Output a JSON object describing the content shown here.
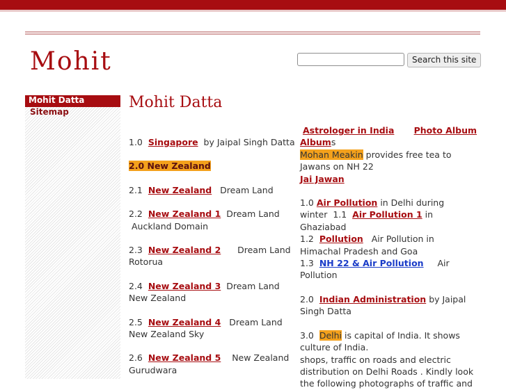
{
  "site": {
    "title": "Mohit"
  },
  "search": {
    "placeholder": "",
    "button_label": "Search this site"
  },
  "sidebar": {
    "items": [
      {
        "label": "Mohit Datta",
        "active": true
      },
      {
        "label": "Sitemap",
        "active": false
      }
    ]
  },
  "page": {
    "heading": "Mohit Datta"
  },
  "left_column": {
    "e1": {
      "num": "1.0",
      "link": "Singapore",
      "text": "by Jaipal Singh Datta"
    },
    "e2": {
      "label": "2.0  New Zealand"
    },
    "e3": {
      "num": "2.1",
      "link": "New Zealand",
      "text": "Dream Land"
    },
    "e4": {
      "num": "2.2",
      "link": "New Zealand 1",
      "text": "Dream Land",
      "text2": "Auckland Domain"
    },
    "e5": {
      "num": "2.3",
      "link": "New Zealand 2",
      "text": "Dream Land",
      "text2": "Rotorua"
    },
    "e6": {
      "num": "2.4",
      "link": "New Zealand 3",
      "text": "Dream Land",
      "text2": "New Zealand"
    },
    "e7": {
      "num": "2.5",
      "link": "New Zealand 4",
      "text": "Dream Land",
      "text2": "New Zealand Sky"
    },
    "e8": {
      "num": "2.6",
      "link": "New Zealand 5",
      "text": "New Zealand",
      "text2": "Gurudwara"
    }
  },
  "right_column": {
    "astrologer_link": "Astrologer in India",
    "photo_album_link": "Photo Album",
    "photo_album_suffix": "s",
    "mohan_meakin": "Mohan Meakin",
    "mohan_text": "provides free tea to Jawans on NH 22",
    "jai_jawan": "Jai Jawan",
    "ap": {
      "num": "1.0",
      "link": "Air Pollution",
      "text": "in Delhi during winter"
    },
    "ap1": {
      "num": "1.1",
      "link": "Air Pollution 1",
      "text": "in Ghaziabad"
    },
    "ap2": {
      "num": "1.2",
      "link": "Pollution",
      "text": "Air Pollution in Himachal Pradesh and Goa"
    },
    "ap3": {
      "num": "1.3",
      "link": "NH 22 & Air Pollution",
      "text": "Air Pollution"
    },
    "ia": {
      "num": "2.0",
      "link": "Indian Administration",
      "text": "by Jaipal Singh Datta"
    },
    "delhi": {
      "num": "3.0",
      "word": "Delhi",
      "text": "is capital of India. It shows culture of India.",
      "text2": "shops,  traffic on roads and electric distribution on Delhi Roads . Kindly look the following photographs of traffic and"
    }
  },
  "colors": {
    "brand": "#a70d11",
    "highlight": "#f4a11c",
    "link_blue": "#1a3cc8"
  }
}
